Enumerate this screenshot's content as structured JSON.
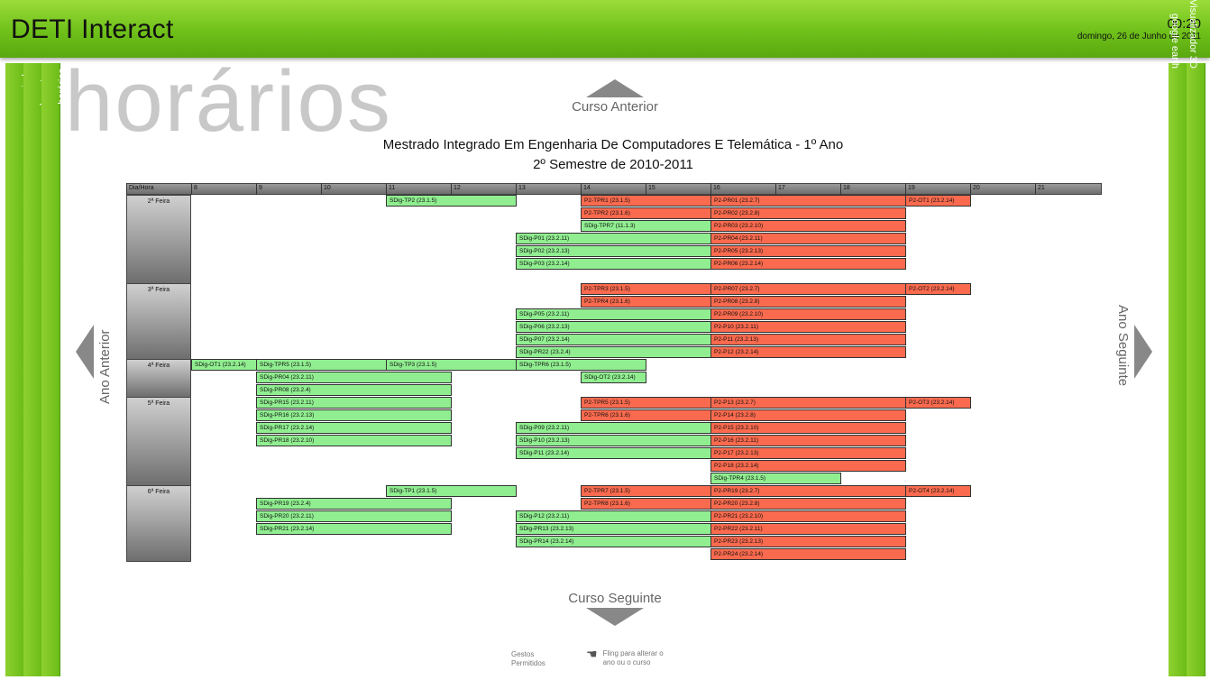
{
  "header": {
    "title": "DETI Interact",
    "time": "00:20",
    "date": "domingo, 26 de Junho de 2011"
  },
  "side_tabs": {
    "left": [
      "ajuda",
      "docentes",
      "horários"
    ],
    "right": [
      "google earth",
      "Visualizador 3D"
    ]
  },
  "section_title": "horários",
  "nav": {
    "prev_course": "Curso Anterior",
    "next_course": "Curso Seguinte",
    "prev_year": "Ano Anterior",
    "next_year": "Ano Seguinte"
  },
  "course": {
    "name": "Mestrado Integrado Em Engenharia De Computadores E Telemática - 1º Ano",
    "semester": "2º Semestre de 2010-2011"
  },
  "timetable": {
    "corner": "Dia/Hora",
    "hours": [
      "8",
      "9",
      "10",
      "11",
      "12",
      "13",
      "14",
      "15",
      "16",
      "17",
      "18",
      "19",
      "20",
      "21"
    ],
    "days": [
      {
        "label": "2ª Feira",
        "rows": 7
      },
      {
        "label": "3ª Feira",
        "rows": 6
      },
      {
        "label": "4ª Feira",
        "rows": 3
      },
      {
        "label": "5ª Feira",
        "rows": 7
      },
      {
        "label": "6ª Feira",
        "rows": 6
      }
    ],
    "events": [
      {
        "row": 0,
        "start": 11,
        "end": 13,
        "label": "SDig-TP2 (23.1.5)",
        "color": "g"
      },
      {
        "row": 0,
        "start": 14,
        "end": 16,
        "label": "P2-TPR1 (23.1.5)",
        "color": "r"
      },
      {
        "row": 0,
        "start": 16,
        "end": 19,
        "label": "P2-PR01 (23.2.7)",
        "color": "r"
      },
      {
        "row": 0,
        "start": 19,
        "end": 20,
        "label": "P2-OT1 (23.2.14)",
        "color": "r"
      },
      {
        "row": 1,
        "start": 14,
        "end": 16,
        "label": "P2-TPR2 (23.1.6)",
        "color": "r"
      },
      {
        "row": 1,
        "start": 16,
        "end": 19,
        "label": "P2-PR02 (23.2.8)",
        "color": "r"
      },
      {
        "row": 2,
        "start": 14,
        "end": 16,
        "label": "SDig-TPR7 (11.1.3)",
        "color": "g"
      },
      {
        "row": 2,
        "start": 16,
        "end": 19,
        "label": "P2-PR03 (23.2.10)",
        "color": "r"
      },
      {
        "row": 3,
        "start": 13,
        "end": 16,
        "label": "SDig-P01 (23.2.11)",
        "color": "g"
      },
      {
        "row": 3,
        "start": 16,
        "end": 19,
        "label": "P2-PR04 (23.2.11)",
        "color": "r"
      },
      {
        "row": 4,
        "start": 13,
        "end": 16,
        "label": "SDig-P02 (23.2.13)",
        "color": "g"
      },
      {
        "row": 4,
        "start": 16,
        "end": 19,
        "label": "P2-PR05 (23.2.13)",
        "color": "r"
      },
      {
        "row": 5,
        "start": 13,
        "end": 16,
        "label": "SDig-P03 (23.2.14)",
        "color": "g"
      },
      {
        "row": 5,
        "start": 16,
        "end": 19,
        "label": "P2-PR06 (23.2.14)",
        "color": "r"
      },
      {
        "row": 7,
        "start": 14,
        "end": 16,
        "label": "P2-TPR3 (23.1.5)",
        "color": "r"
      },
      {
        "row": 7,
        "start": 16,
        "end": 19,
        "label": "P2-PR07 (23.2.7)",
        "color": "r"
      },
      {
        "row": 7,
        "start": 19,
        "end": 20,
        "label": "P2-OT2 (23.2.14)",
        "color": "r"
      },
      {
        "row": 8,
        "start": 14,
        "end": 16,
        "label": "P2-TPR4 (23.1.6)",
        "color": "r"
      },
      {
        "row": 8,
        "start": 16,
        "end": 19,
        "label": "P2-PR08 (23.2.8)",
        "color": "r"
      },
      {
        "row": 9,
        "start": 13,
        "end": 16,
        "label": "SDig-P05 (23.2.11)",
        "color": "g"
      },
      {
        "row": 9,
        "start": 16,
        "end": 19,
        "label": "P2-PR09 (23.2.10)",
        "color": "r"
      },
      {
        "row": 10,
        "start": 13,
        "end": 16,
        "label": "SDig-P06 (23.2.13)",
        "color": "g"
      },
      {
        "row": 10,
        "start": 16,
        "end": 19,
        "label": "P2-P10 (23.2.11)",
        "color": "r"
      },
      {
        "row": 11,
        "start": 13,
        "end": 16,
        "label": "SDig-P07 (23.2.14)",
        "color": "g"
      },
      {
        "row": 11,
        "start": 16,
        "end": 19,
        "label": "P2-P11 (23.2.13)",
        "color": "r"
      },
      {
        "row": 12,
        "start": 13,
        "end": 16,
        "label": "SDig-PR22 (23.2.4)",
        "color": "g"
      },
      {
        "row": 12,
        "start": 16,
        "end": 19,
        "label": "P2-P12 (23.2.14)",
        "color": "r"
      },
      {
        "row": 13,
        "start": 8,
        "end": 9,
        "label": "SDig-OT1 (23.2.14)",
        "color": "g"
      },
      {
        "row": 13,
        "start": 9,
        "end": 11,
        "label": "SDig-TPR5 (23.1.5)",
        "color": "g"
      },
      {
        "row": 13,
        "start": 11,
        "end": 13,
        "label": "SDig-TP3 (23.1.5)",
        "color": "g"
      },
      {
        "row": 13,
        "start": 13,
        "end": 15,
        "label": "SDig-TPR6 (23.1.5)",
        "color": "g"
      },
      {
        "row": 14,
        "start": 9,
        "end": 12,
        "label": "SDig-PR04 (23.2.11)",
        "color": "g"
      },
      {
        "row": 14,
        "start": 14,
        "end": 15,
        "label": "SDig-OT2 (23.2.14)",
        "color": "g"
      },
      {
        "row": 15,
        "start": 9,
        "end": 12,
        "label": "SDig-PR08 (23.2.4)",
        "color": "g"
      },
      {
        "row": 16,
        "start": 9,
        "end": 12,
        "label": "SDig-PR15 (23.2.11)",
        "color": "g"
      },
      {
        "row": 16,
        "start": 14,
        "end": 16,
        "label": "P2-TPR5 (23.1.5)",
        "color": "r"
      },
      {
        "row": 16,
        "start": 16,
        "end": 19,
        "label": "P2-P13 (23.2.7)",
        "color": "r"
      },
      {
        "row": 16,
        "start": 19,
        "end": 20,
        "label": "P2-OT3 (23.2.14)",
        "color": "r"
      },
      {
        "row": 17,
        "start": 9,
        "end": 12,
        "label": "SDig-PR16 (23.2.13)",
        "color": "g"
      },
      {
        "row": 17,
        "start": 14,
        "end": 16,
        "label": "P2-TPR6 (23.1.6)",
        "color": "r"
      },
      {
        "row": 17,
        "start": 16,
        "end": 19,
        "label": "P2-P14 (23.2.8)",
        "color": "r"
      },
      {
        "row": 18,
        "start": 9,
        "end": 12,
        "label": "SDig-PR17 (23.2.14)",
        "color": "g"
      },
      {
        "row": 18,
        "start": 13,
        "end": 16,
        "label": "SDig-P09 (23.2.11)",
        "color": "g"
      },
      {
        "row": 18,
        "start": 16,
        "end": 19,
        "label": "P2-P15 (23.2.10)",
        "color": "r"
      },
      {
        "row": 19,
        "start": 9,
        "end": 12,
        "label": "SDig-PR18 (23.2.10)",
        "color": "g"
      },
      {
        "row": 19,
        "start": 13,
        "end": 16,
        "label": "SDig-P10 (23.2.13)",
        "color": "g"
      },
      {
        "row": 19,
        "start": 16,
        "end": 19,
        "label": "P2-P16 (23.2.11)",
        "color": "r"
      },
      {
        "row": 20,
        "start": 13,
        "end": 16,
        "label": "SDig-P11 (23.2.14)",
        "color": "g"
      },
      {
        "row": 20,
        "start": 16,
        "end": 19,
        "label": "P2-P17 (23.2.13)",
        "color": "r"
      },
      {
        "row": 21,
        "start": 16,
        "end": 19,
        "label": "P2-P18 (23.2.14)",
        "color": "r"
      },
      {
        "row": 22,
        "start": 16,
        "end": 18,
        "label": "SDig-TPR4 (23.1.5)",
        "color": "g"
      },
      {
        "row": 23,
        "start": 11,
        "end": 13,
        "label": "SDig-TP1 (23.1.5)",
        "color": "g"
      },
      {
        "row": 23,
        "start": 14,
        "end": 16,
        "label": "P2-TPR7 (23.1.5)",
        "color": "r"
      },
      {
        "row": 23,
        "start": 16,
        "end": 19,
        "label": "P2-PR19 (23.2.7)",
        "color": "r"
      },
      {
        "row": 23,
        "start": 19,
        "end": 20,
        "label": "P2-OT4 (23.2.14)",
        "color": "r"
      },
      {
        "row": 24,
        "start": 9,
        "end": 12,
        "label": "SDig-PR19 (23.2.4)",
        "color": "g"
      },
      {
        "row": 24,
        "start": 14,
        "end": 16,
        "label": "P2-TPR8 (23.1.6)",
        "color": "r"
      },
      {
        "row": 24,
        "start": 16,
        "end": 19,
        "label": "P2-PR20 (23.2.8)",
        "color": "r"
      },
      {
        "row": 25,
        "start": 9,
        "end": 12,
        "label": "SDig-PR20 (23.2.11)",
        "color": "g"
      },
      {
        "row": 25,
        "start": 13,
        "end": 16,
        "label": "SDig-P12 (23.2.11)",
        "color": "g"
      },
      {
        "row": 25,
        "start": 16,
        "end": 19,
        "label": "P2-PR21 (23.2.10)",
        "color": "r"
      },
      {
        "row": 26,
        "start": 9,
        "end": 12,
        "label": "SDig-PR21 (23.2.14)",
        "color": "g"
      },
      {
        "row": 26,
        "start": 13,
        "end": 16,
        "label": "SDig-PR13 (23.2.13)",
        "color": "g"
      },
      {
        "row": 26,
        "start": 16,
        "end": 19,
        "label": "P2-PR22 (23.2.11)",
        "color": "r"
      },
      {
        "row": 27,
        "start": 13,
        "end": 16,
        "label": "SDig-PR14 (23.2.14)",
        "color": "g"
      },
      {
        "row": 27,
        "start": 16,
        "end": 19,
        "label": "P2-PR23 (23.2.13)",
        "color": "r"
      },
      {
        "row": 28,
        "start": 16,
        "end": 19,
        "label": "P2-PR24 (23.2.14)",
        "color": "r"
      }
    ]
  },
  "footer": {
    "gestures": "Gestos Permitidos",
    "fling": "Fling para alterar o ano ou o curso",
    "fling_icon": "hand-swipe-icon"
  }
}
